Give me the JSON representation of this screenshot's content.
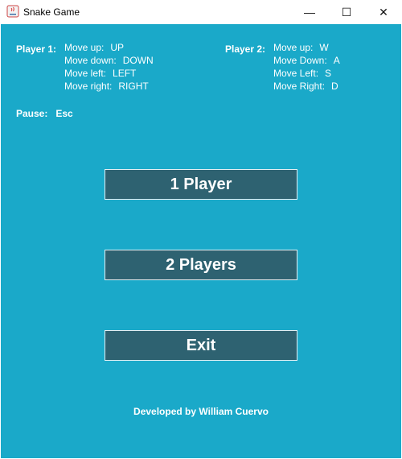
{
  "window": {
    "title": "Snake Game",
    "minimize_glyph": "—",
    "maximize_glyph": "☐",
    "close_glyph": "✕"
  },
  "controls": {
    "player1": {
      "label": "Player 1:",
      "lines": [
        {
          "action": "Move up:",
          "key": "UP"
        },
        {
          "action": "Move down:",
          "key": "DOWN"
        },
        {
          "action": "Move left:",
          "key": "LEFT"
        },
        {
          "action": "Move right:",
          "key": "RIGHT"
        }
      ]
    },
    "player2": {
      "label": "Player 2:",
      "lines": [
        {
          "action": "Move up:",
          "key": "W"
        },
        {
          "action": "Move Down:",
          "key": "A"
        },
        {
          "action": "Move Left:",
          "key": "S"
        },
        {
          "action": "Move Right:",
          "key": "D"
        }
      ]
    },
    "pause": {
      "label": "Pause:",
      "key": "Esc"
    }
  },
  "buttons": {
    "one_player": "1 Player",
    "two_players": "2 Players",
    "exit": "Exit"
  },
  "footer": "Developed by William Cuervo",
  "colors": {
    "background": "#1aa9c9",
    "button": "#2e6271",
    "text": "#ffffff"
  }
}
